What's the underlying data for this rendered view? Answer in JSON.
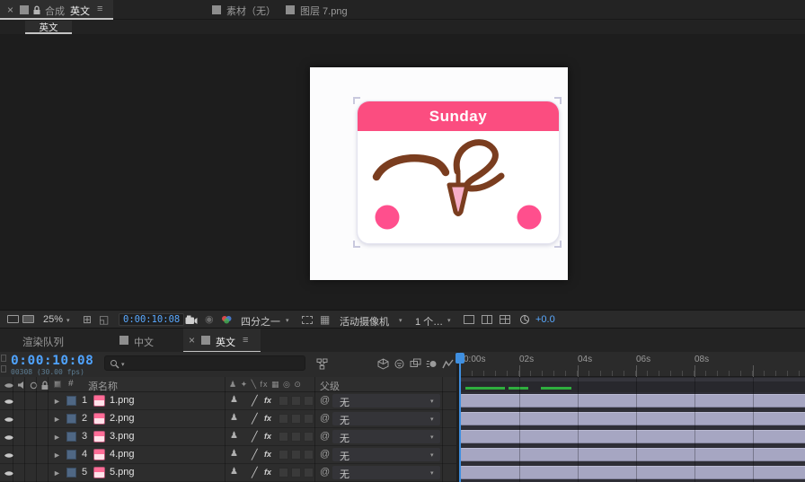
{
  "comp_panel": {
    "close": "×",
    "menu": "≡",
    "tab_composition_prefix": "合成",
    "tab_composition_name": "英文",
    "tab_footage": "素材（无）",
    "tab_layer": "图层 7.png",
    "viewer_tab": "英文"
  },
  "canvas": {
    "card_title": "Sunday"
  },
  "viewer_toolbar": {
    "zoom": "25%",
    "timecode": "0:00:10:08",
    "resolution": "四分之一",
    "camera_view": "活动摄像机",
    "view_layout": "1 个…",
    "exposure": "+0.0"
  },
  "timeline_panel": {
    "tab_render_queue": "渲染队列",
    "tab_zh": "中文",
    "tab_en": "英文",
    "close": "×",
    "menu": "≡",
    "timecode": "0:00:10:08",
    "frame_info": "00308 (30.00 fps)",
    "columns": {
      "hash": "#",
      "source_name": "源名称",
      "parent": "父级"
    },
    "switches_header": "♟ ✦ ╲ fx ▦ ◎ ⊙",
    "ruler_labels": [
      "0:00s",
      "02s",
      "04s",
      "06s",
      "08s"
    ],
    "layers": [
      {
        "num": "1",
        "name": "1.png",
        "parent": "无"
      },
      {
        "num": "2",
        "name": "2.png",
        "parent": "无"
      },
      {
        "num": "3",
        "name": "3.png",
        "parent": "无"
      },
      {
        "num": "4",
        "name": "4.png",
        "parent": "无"
      },
      {
        "num": "5",
        "name": "5.png",
        "parent": "无"
      }
    ]
  },
  "icons": {
    "expander": "►",
    "dropdown": "▾",
    "grid_options": "⊞",
    "mask_visibility": "◱",
    "transparency_grid": "▦",
    "snapshot_show": "◉",
    "pickwhip": "@",
    "shy": "♟",
    "quality": "╱",
    "fx": "fx"
  },
  "colors": {
    "accent_blue": "#4fa3ff",
    "header_pink": "#fb4d80",
    "cheek_pink": "#ff4f8d",
    "doodle_brown": "#7a3d1f",
    "layer_bar": "#a6a6c2",
    "cache_green": "#2fae3e"
  }
}
